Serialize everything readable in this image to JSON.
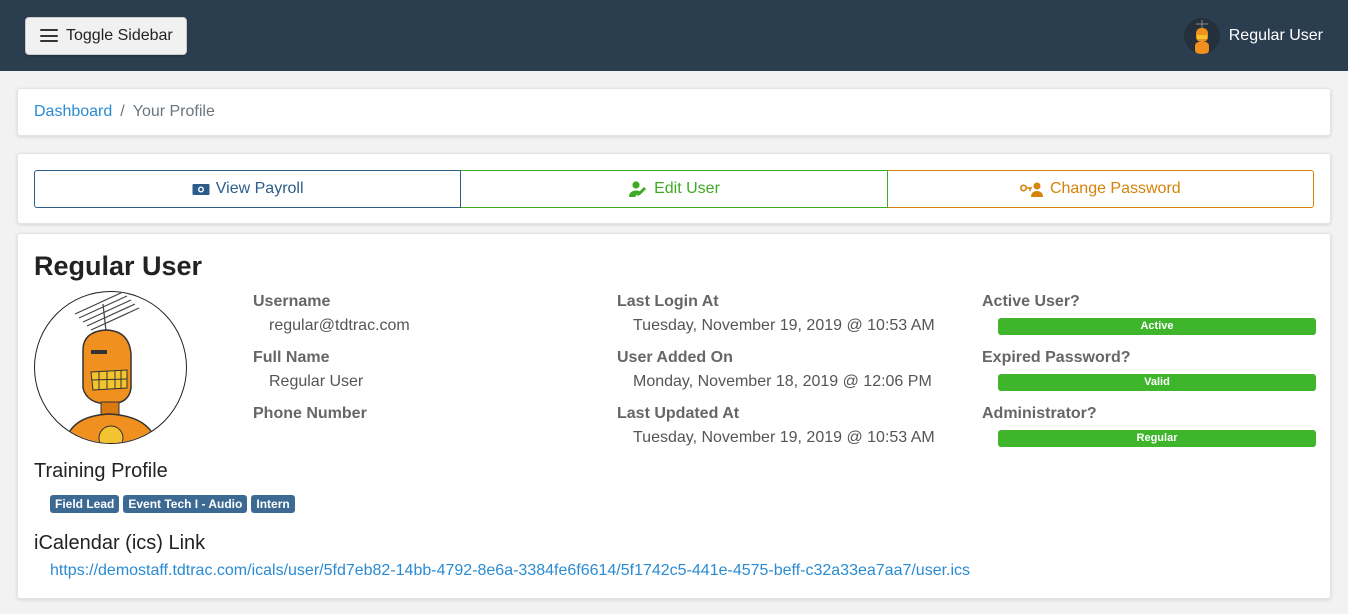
{
  "topbar": {
    "toggle_label": "Toggle Sidebar",
    "user_name": "Regular User"
  },
  "breadcrumb": {
    "home": "Dashboard",
    "separator": "/",
    "current": "Your Profile"
  },
  "actions": {
    "payroll": "View Payroll",
    "edit": "Edit User",
    "password": "Change Password"
  },
  "profile": {
    "name": "Regular User",
    "username_label": "Username",
    "username": "regular@tdtrac.com",
    "fullname_label": "Full Name",
    "fullname": "Regular User",
    "phone_label": "Phone Number",
    "phone": "",
    "last_login_label": "Last Login At",
    "last_login": "Tuesday, November 19, 2019 @ 10:53 AM",
    "added_label": "User Added On",
    "added": "Monday, November 18, 2019 @ 12:06 PM",
    "updated_label": "Last Updated At",
    "updated": "Tuesday, November 19, 2019 @ 10:53 AM",
    "active_label": "Active User?",
    "active": "Active",
    "expired_label": "Expired Password?",
    "expired": "Valid",
    "admin_label": "Administrator?",
    "admin": "Regular",
    "training_title": "Training Profile",
    "training_tags": [
      "Field Lead",
      "Event Tech I - Audio",
      "Intern"
    ],
    "ical_title": "iCalendar (ics) Link",
    "ical_url": "https://demostaff.tdtrac.com/icals/user/5fd7eb82-14bb-4792-8e6a-3384fe6f6614/5f1742c5-441e-4575-beff-c32a33ea7aa7/user.ics"
  },
  "colors": {
    "topbar": "#2b3e50",
    "link": "#2a8bd3",
    "payroll": "#2c5c8a",
    "edit": "#3eaa24",
    "password": "#d5830a",
    "status_badge": "#3eb52b",
    "tag": "#3d6a93"
  },
  "icons": {
    "toggle": "hamburger-icon",
    "payroll": "money-bill-icon",
    "edit": "user-edit-icon",
    "password": "user-key-icon",
    "avatar": "robot-avatar"
  }
}
